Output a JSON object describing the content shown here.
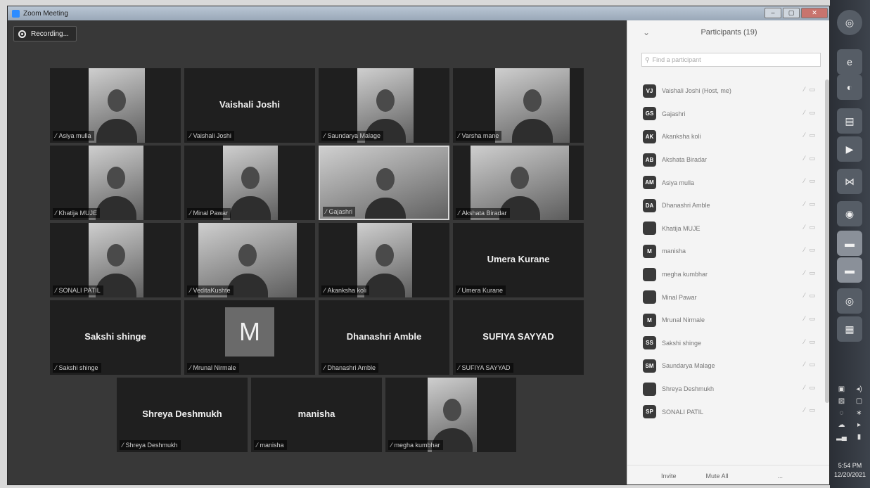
{
  "window": {
    "title": "Zoom Meeting"
  },
  "recording": {
    "label": "Recording..."
  },
  "tiles": [
    {
      "name": "Asiya mulla",
      "kind": "video"
    },
    {
      "name": "Vaishali Joshi",
      "kind": "name",
      "display": "Vaishali Joshi"
    },
    {
      "name": "Saundarya Malage",
      "kind": "video"
    },
    {
      "name": "Varsha mane",
      "kind": "video"
    },
    {
      "name": "Khatija MUJE",
      "kind": "video"
    },
    {
      "name": "Minal Pawar",
      "kind": "video"
    },
    {
      "name": "Gajashri",
      "kind": "video",
      "active": true
    },
    {
      "name": "Akshata Biradar",
      "kind": "video"
    },
    {
      "name": "SONALI PATIL",
      "kind": "video"
    },
    {
      "name": "VeditaKushte",
      "kind": "video"
    },
    {
      "name": "Akanksha koli",
      "kind": "video"
    },
    {
      "name": "Umera Kurane",
      "kind": "name",
      "display": "Umera Kurane"
    },
    {
      "name": "Sakshi shinge",
      "kind": "name",
      "display": "Sakshi shinge"
    },
    {
      "name": "Mrunal Nirmale",
      "kind": "avatar",
      "display": "M"
    },
    {
      "name": "Dhanashri Amble",
      "kind": "name",
      "display": "Dhanashri Amble"
    },
    {
      "name": "SUFIYA SAYYAD",
      "kind": "name",
      "display": "SUFIYA SAYYAD"
    },
    {
      "name": "Shreya Deshmukh",
      "kind": "name",
      "display": "Shreya Deshmukh"
    },
    {
      "name": "manisha",
      "kind": "name",
      "display": "manisha"
    },
    {
      "name": "megha kumbhar",
      "kind": "video"
    }
  ],
  "panel": {
    "title": "Participants (19)",
    "search_placeholder": "Find a participant",
    "participants": [
      {
        "initials": "VJ",
        "name": "Vaishali Joshi (Host, me)"
      },
      {
        "initials": "GS",
        "name": "Gajashri"
      },
      {
        "initials": "AK",
        "name": "Akanksha koli"
      },
      {
        "initials": "AB",
        "name": "Akshata Biradar"
      },
      {
        "initials": "AM",
        "name": "Asiya mulla"
      },
      {
        "initials": "DA",
        "name": "Dhanashri Amble"
      },
      {
        "initials": "",
        "name": "Khatija MUJE"
      },
      {
        "initials": "M",
        "name": "manisha"
      },
      {
        "initials": "",
        "name": "megha kumbhar"
      },
      {
        "initials": "",
        "name": "Minal Pawar"
      },
      {
        "initials": "M",
        "name": "Mrunal Nirmale"
      },
      {
        "initials": "SS",
        "name": "Sakshi shinge"
      },
      {
        "initials": "SM",
        "name": "Saundarya Malage"
      },
      {
        "initials": "",
        "name": "Shreya Deshmukh"
      },
      {
        "initials": "SP",
        "name": "SONALI PATIL"
      }
    ],
    "footer": {
      "invite": "Invite",
      "mute_all": "Mute All",
      "more": "..."
    }
  },
  "taskbar": {
    "time": "5:54 PM",
    "date": "12/20/2021"
  }
}
